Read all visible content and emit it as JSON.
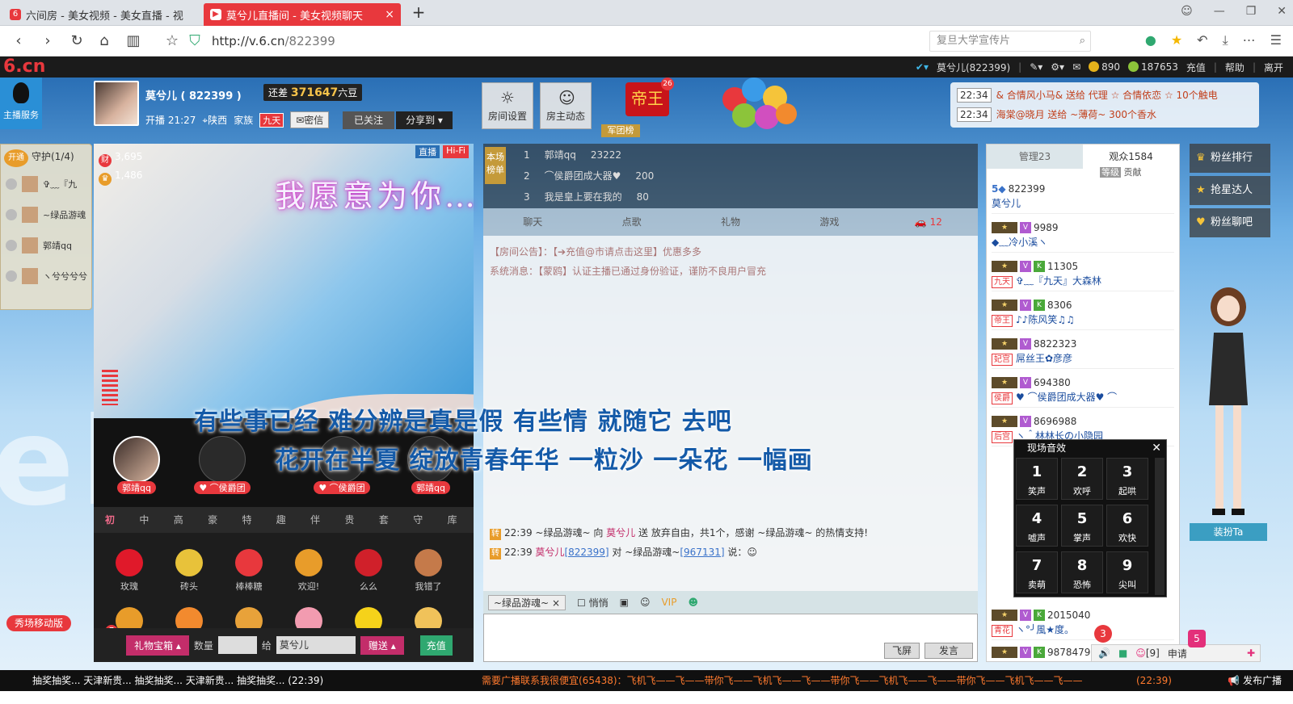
{
  "browser": {
    "tabs": [
      {
        "icon": "6",
        "title": "六间房 - 美女视频 - 美女直播 - 视"
      },
      {
        "icon": "▶",
        "title": "莫兮儿直播间 - 美女视频聊天"
      }
    ],
    "url_host": "http://v.6.cn",
    "url_path": "/822399",
    "search_placeholder": "复旦大学宣传片"
  },
  "site": {
    "logo": "6.cn",
    "user_name": "莫兮儿(822399)",
    "coins": "890",
    "beans": "187653",
    "links": [
      "充值",
      "帮助",
      "离开"
    ]
  },
  "host": {
    "service_label": "主播服务",
    "name": "莫兮儿 ( 822399 )",
    "gap_label": "还差",
    "gap_value": "371647",
    "gap_unit": "六豆",
    "live_time": "开播 21:27",
    "location": "陕西",
    "family_label": "家族",
    "family_tag": "九天",
    "private_msg": "密信",
    "followed": "已关注",
    "share": "分享到"
  },
  "room_buttons": [
    {
      "icon": "☼",
      "label": "房间设置"
    },
    {
      "icon": "☺",
      "label": "房主动态"
    }
  ],
  "emperor": {
    "title": "帝王",
    "level": "26",
    "army": "军团榜"
  },
  "broadcast": [
    {
      "time": "22:34",
      "text": "& 合情风小马& 送给 代理 ☆ 合情依恋 ☆ 10个触电"
    },
    {
      "time": "22:34",
      "text": "海棠@晓月 送给 ~薄荷~ 300个香水"
    }
  ],
  "guard": {
    "open": "开通",
    "title": "守护(1/4)",
    "items": [
      "✞﹏『九",
      "~绿品游魂",
      "郭靖qq",
      "ヽ兮兮兮兮"
    ]
  },
  "video": {
    "wealth": "3,695",
    "fans": "1,486",
    "tag_live": "直播",
    "tag_hifi": "Hi-Fi",
    "overlay_line": "我愿意为你…",
    "lyric1": "有些事已经 难分辨是真是假 有些情 就随它 去吧",
    "lyric2": "花开在半夏 绽放青春年华 一粒沙 一朵花 一幅画"
  },
  "mics": [
    "郭靖qq",
    "♥ ⌒侯爵团",
    "♥ ⌒侯爵团",
    "郭靖qq"
  ],
  "gift_tabs": [
    "初级",
    "中级",
    "高级",
    "豪华",
    "特殊",
    "趣味",
    "伴舞",
    "贵族",
    "套礼",
    "守护",
    "库存"
  ],
  "gifts": [
    {
      "name": "玫瑰",
      "color": "#e0192a"
    },
    {
      "name": "砖头",
      "color": "#e8c23a"
    },
    {
      "name": "棒棒糖",
      "color": "#e8383d"
    },
    {
      "name": "欢迎!",
      "color": "#e89c2a"
    },
    {
      "name": "么么",
      "color": "#d0202a"
    },
    {
      "name": "我错了",
      "color": "#c57a4a"
    }
  ],
  "send": {
    "corner_badge": "7",
    "corner_label": "财",
    "treasure": "礼物宝箱",
    "qty_label": "数量",
    "to_label": "给",
    "to_value": "莫兮儿",
    "give": "赠送",
    "recharge": "充值",
    "mobile_show": "秀场移动版"
  },
  "rank": {
    "label": "本场榜单",
    "rows": [
      {
        "pos": "1",
        "name": "郭靖qq",
        "score": "23222"
      },
      {
        "pos": "2",
        "name": "⌒侯爵团成大器♥",
        "score": "200"
      },
      {
        "pos": "3",
        "name": "我是皇上要在我的",
        "score": "80"
      }
    ]
  },
  "chat_tabs": [
    "聊天",
    "点歌",
    "礼物",
    "游戏"
  ],
  "car_badge": "12",
  "chat": {
    "announce": "【房间公告】：【➔充值@市请点击这里】优惠多多",
    "system": "系统消息：【蒙鸥】认证主播已通过身份验证，谨防不良用户冒充",
    "lines": [
      {
        "time": "22:39",
        "text1": "~绿品游魂~ 向 ",
        "nick": "莫兮儿",
        "text2": " 送 放弃自由，共1个，感谢 ~绿品游魂~ 的热情支持!"
      },
      {
        "time": "22:39",
        "text1": "莫兮儿",
        "uid1": "[822399]",
        "text2": " 对 ~绿品游魂~",
        "uid2": "[967131]",
        "text3": " 说："
      }
    ],
    "to_whom": "~绿品游魂~",
    "whisper": "悄悄",
    "fly": "飞屏",
    "send": "发言"
  },
  "userlist": {
    "tab_admin": "管理23",
    "tab_audience": "观众1584",
    "sort_level": "等级",
    "sort_contrib": "贡献",
    "rows": [
      {
        "uid": "822399",
        "name": "莫兮儿",
        "tag": ""
      },
      {
        "uid": "9989",
        "name": "◆﹏冷小溪ヽ",
        "tag": ""
      },
      {
        "uid": "11305",
        "name": "✞﹏『九天』大森林",
        "tag": "九天"
      },
      {
        "uid": "8306",
        "name": "♪♪陈风笑♫♫",
        "tag": "帝王"
      },
      {
        "uid": "8822323",
        "name": "屌丝王✿彦彦",
        "tag": "妃宫"
      },
      {
        "uid": "694380",
        "name": "♥ ⌒侯爵团成大器♥ ⌒",
        "tag": "侯爵"
      },
      {
        "uid": "8696988",
        "name": "ヽ＾林林长の小隐园",
        "tag": "后宫"
      },
      {
        "uid": "2015040",
        "name": "ヽ°╯風★度。",
        "tag": "青花"
      },
      {
        "uid": "9878479",
        "name": "",
        "tag": ""
      }
    ]
  },
  "side_buttons": [
    {
      "icon": "♛",
      "label": "粉丝排行"
    },
    {
      "icon": "★",
      "label": "抢星达人"
    },
    {
      "icon": "♥",
      "label": "粉丝聊吧"
    }
  ],
  "dressup": "装扮Ta",
  "sfx": {
    "title": "现场音效",
    "keys": [
      {
        "n": "1",
        "t": "笑声"
      },
      {
        "n": "2",
        "t": "欢呼"
      },
      {
        "n": "3",
        "t": "起哄"
      },
      {
        "n": "4",
        "t": "嘘声"
      },
      {
        "n": "5",
        "t": "掌声"
      },
      {
        "n": "6",
        "t": "欢快"
      },
      {
        "n": "7",
        "t": "卖萌"
      },
      {
        "n": "8",
        "t": "恐怖"
      },
      {
        "n": "9",
        "t": "尖叫"
      }
    ]
  },
  "controls": {
    "mic_count": "[9]",
    "apply": "申请",
    "badge_red": "3",
    "badge_pink": "5"
  },
  "ticker": {
    "left": "抽奖抽奖... 天津新贵... 抽奖抽奖... 天津新贵... 抽奖抽奖...  (22:39)",
    "middle": "需要广播联系我很便宜(65438)：飞机飞——飞——带你飞——飞机飞——飞——带你飞——飞机飞——飞——带你飞——飞机飞——飞——",
    "right": "(22:39)",
    "publish": "发布广播"
  }
}
